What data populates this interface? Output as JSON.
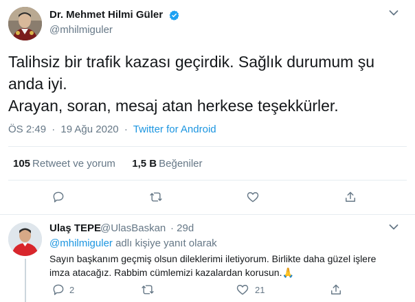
{
  "tweet": {
    "author_name": "Dr. Mehmet Hilmi Güler",
    "author_handle": "@mhilmiguler",
    "text_lines": [
      "Talihsiz bir trafik kazası geçirdik. Sağlık durumum şu",
      "anda iyi.",
      "Arayan, soran, mesaj atan herkese teşekkürler."
    ],
    "time": "ÖS 2:49",
    "date": "19 Ağu 2020",
    "separator": "·",
    "source": "Twitter for Android",
    "retweet_count": "105",
    "retweet_label": "Retweet ve yorum",
    "like_count": "1,5 B",
    "like_label": "Beğeniler"
  },
  "reply": {
    "author_name": "Ulaş TEPE",
    "author_handle": "@UlasBaskan",
    "time": "· 29d",
    "replying_mention": "@mhilmiguler",
    "replying_suffix": " adlı kişiye yanıt olarak",
    "text_lines": [
      "Sayın başkanım geçmiş olsun dileklerimi iletiyorum. Birlikte daha güzel işlere",
      "imza atacağız. Rabbim cümlemizi kazalardan korusun.🙏"
    ],
    "reply_count": "2",
    "like_count": "21"
  },
  "colors": {
    "accent": "#1b95e0",
    "muted": "#657786",
    "text": "#14171a",
    "border": "#e6ecf0",
    "verified": "#1da1f2"
  },
  "icons": [
    "verified-badge-icon",
    "chevron-down-icon",
    "reply-icon",
    "retweet-icon",
    "like-icon",
    "share-icon",
    "folded-hands-emoji"
  ]
}
